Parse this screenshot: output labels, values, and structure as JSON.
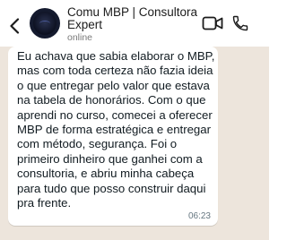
{
  "header": {
    "contact_name": "Comu MBP | Consultora Expert",
    "status": "online",
    "icons": {
      "back": "chevron-left-icon",
      "video": "video-call-icon",
      "call": "phone-call-icon"
    }
  },
  "chat": {
    "messages": [
      {
        "text": "Eu achava que sabia elaborar o MBP, mas com toda certeza não fazia ideia o que entregar pelo valor que estava na tabela de honorários. Com o que aprendi no curso, comecei a oferecer MBP de forma estratégica e entregar com método, segurança. Foi o primeiro dinheiro que ganhei com a consultoria, e abriu minha cabeça para tudo que posso construir daqui pra frente.",
        "time": "06:23"
      }
    ]
  },
  "colors": {
    "chat_background": "#ede5dc",
    "bubble": "#ffffff",
    "text": "#111b21",
    "timestamp": "#667781"
  }
}
